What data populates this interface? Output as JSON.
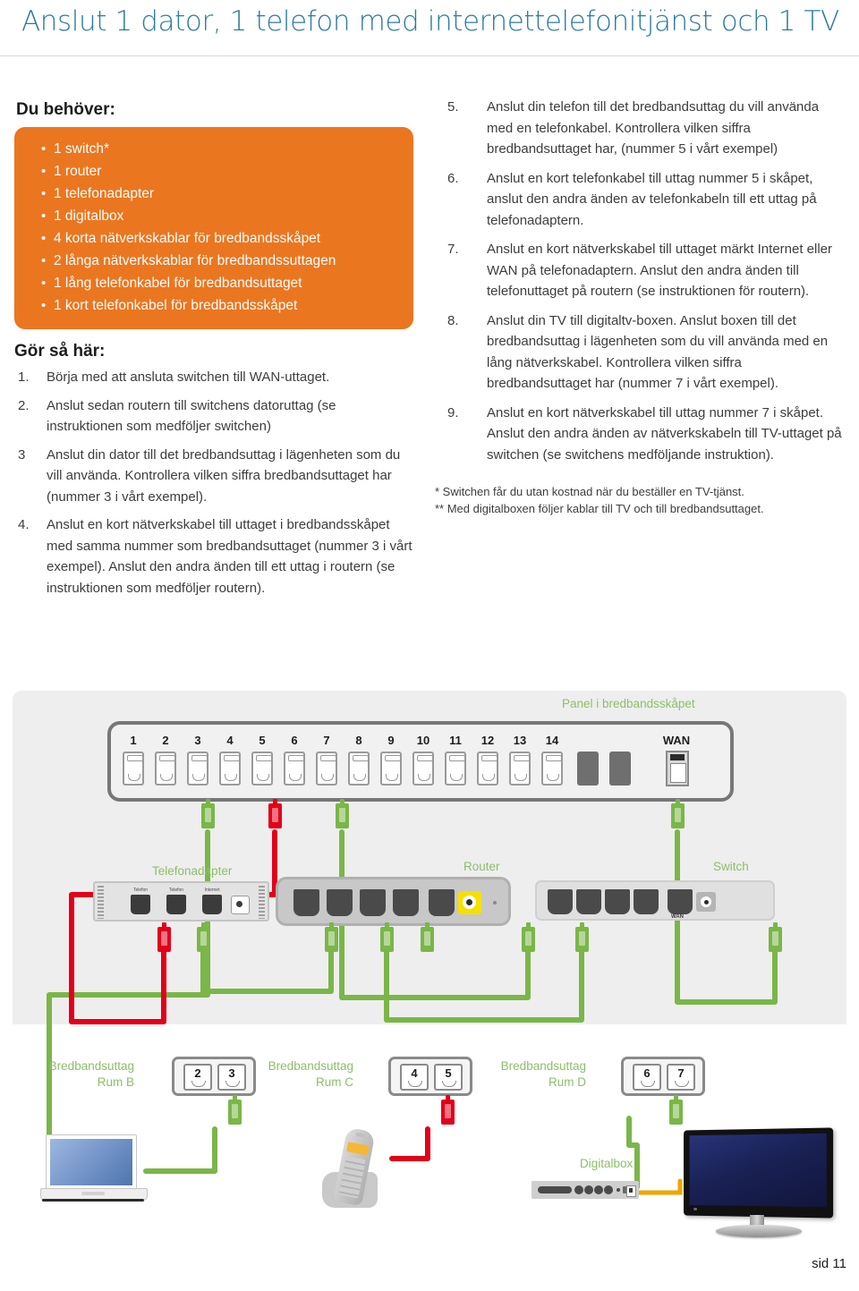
{
  "title": "Anslut 1 dator, 1 telefon med internettelefonitjänst och 1 TV",
  "needs": {
    "heading": "Du behöver:",
    "items": [
      "1 switch*",
      "1 router",
      "1 telefonadapter",
      "1 digitalbox",
      "4 korta nätverkskablar för bredbandsskåpet",
      "2 långa nätverkskablar för bredbandssuttagen",
      "1 lång telefonkabel för bredbandsuttaget",
      "1 kort telefonkabel för bredbandsskåpet"
    ]
  },
  "howto": {
    "heading": "Gör så här:",
    "steps_left": [
      {
        "num": "1.",
        "text": "Börja med att ansluta switchen till WAN-uttaget."
      },
      {
        "num": "2.",
        "text": "Anslut sedan routern till switchens datoruttag (se instruktionen som medföljer switchen)"
      },
      {
        "num": "3",
        "text": "Anslut din dator till det bredbandsuttag i lägenheten som du vill använda. Kontrollera vilken siffra bredbandsuttaget har (nummer 3 i vårt exempel)."
      },
      {
        "num": "4.",
        "text": "Anslut en kort nätverkskabel till uttaget i bredbandsskåpet med samma nummer som bredbandsuttaget (nummer 3 i vårt exempel). Anslut den andra änden till ett uttag i routern  (se instruktionen som medföljer routern)."
      }
    ],
    "steps_right": [
      {
        "num": "5.",
        "text": "Anslut din telefon till det bredbandsuttag du vill använda med en telefonkabel. Kontrollera vilken siffra bredbandsuttaget har, (nummer 5 i vårt exempel)"
      },
      {
        "num": "6.",
        "text": "Anslut en kort telefonkabel till uttag nummer 5 i skåpet, anslut den andra änden av telefonkabeln till ett uttag på telefonadaptern."
      },
      {
        "num": "7.",
        "text": "Anslut en kort nätverkskabel till uttaget märkt Internet eller WAN på telefonadaptern. Anslut den andra änden till telefonuttaget på routern (se instruktionen för routern)."
      },
      {
        "num": "8.",
        "text": "Anslut din TV till digitaltv-boxen. Anslut boxen till det bredbandsuttag i lägenheten som du vill använda med en lång nätverkskabel. Kontrollera vilken siffra bredbandsuttaget har (nummer 7 i vårt exempel)."
      },
      {
        "num": "9.",
        "text": "Anslut en kort nätverkskabel till uttag nummer 7 i skåpet. Anslut den andra änden av nätverkskabeln till TV-uttaget på switchen (se switchens medföljande instruktion)."
      }
    ]
  },
  "footnotes": [
    "* Switchen får du utan kostnad när du beställer en TV-tjänst.",
    "** Med digitalboxen följer kablar till TV och till bredbandsuttaget."
  ],
  "diagram": {
    "panel_label": "Panel i bredbandsskåpet",
    "panel_ports": [
      "1",
      "2",
      "3",
      "4",
      "5",
      "6",
      "7",
      "8",
      "9",
      "10",
      "11",
      "12",
      "13",
      "14"
    ],
    "panel_wan_label": "WAN",
    "devices": {
      "telefonadapter": {
        "label": "Telefonadapter",
        "ports": [
          "Telefon",
          "Telefon",
          "Internet"
        ]
      },
      "router": {
        "label": "Router"
      },
      "switch": {
        "label": "Switch",
        "wan_label": "WAN"
      },
      "digitalbox": {
        "label": "Digitalbox"
      }
    },
    "outlets": [
      {
        "label_line1": "Bredbandsuttag",
        "label_line2": "Rum B",
        "jacks": [
          "2",
          "3"
        ]
      },
      {
        "label_line1": "Bredbandsuttag",
        "label_line2": "Rum C",
        "jacks": [
          "4",
          "5"
        ]
      },
      {
        "label_line1": "Bredbandsuttag",
        "label_line2": "Rum D",
        "jacks": [
          "6",
          "7"
        ]
      }
    ]
  },
  "footer": {
    "page": "sid 11"
  },
  "colors": {
    "title": "#2b7ba0",
    "orange": "#EB7620",
    "green_label": "#8CBF6A",
    "cable_green": "#7ab648",
    "cable_red": "#e2001a",
    "cable_yellow": "#f0a500"
  }
}
